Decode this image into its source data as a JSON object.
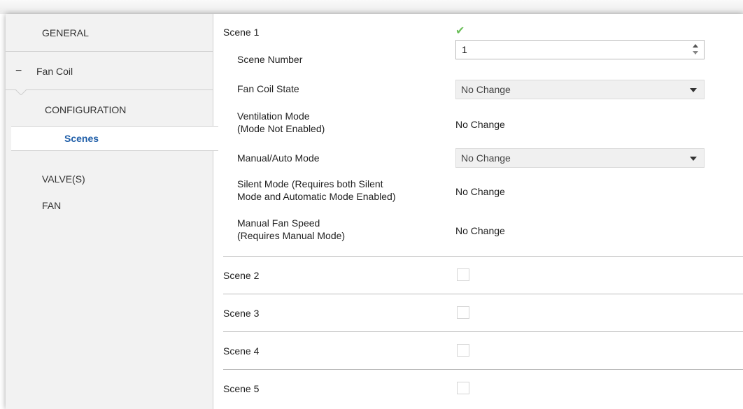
{
  "sidebar": {
    "items": [
      {
        "label": "GENERAL"
      },
      {
        "label": "Fan Coil",
        "toggle": "−"
      },
      {
        "label": "CONFIGURATION"
      },
      {
        "label": "Scenes"
      },
      {
        "label": "VALVE(S)"
      },
      {
        "label": "FAN"
      }
    ]
  },
  "scene1": {
    "label": "Scene 1",
    "checked": true,
    "check_mark": "✔",
    "scene_number": {
      "label": "Scene Number",
      "value": "1"
    },
    "fan_coil_state": {
      "label": "Fan Coil State",
      "value": "No Change"
    },
    "ventilation_mode": {
      "label_line1": "Ventilation Mode",
      "label_line2": "(Mode Not Enabled)",
      "value": "No Change"
    },
    "manual_auto_mode": {
      "label": "Manual/Auto Mode",
      "value": "No Change"
    },
    "silent_mode": {
      "label_line1": "Silent Mode (Requires both Silent",
      "label_line2": "Mode and Automatic Mode Enabled)",
      "value": "No Change"
    },
    "manual_fan_speed": {
      "label_line1": "Manual Fan Speed",
      "label_line2": "(Requires Manual Mode)",
      "value": "No Change"
    }
  },
  "scenes": [
    {
      "label": "Scene 2",
      "checked": false
    },
    {
      "label": "Scene 3",
      "checked": false
    },
    {
      "label": "Scene 4",
      "checked": false
    },
    {
      "label": "Scene 5",
      "checked": false
    }
  ],
  "colors": {
    "accent": "#1f5ea8",
    "check": "#6cbf5a"
  }
}
